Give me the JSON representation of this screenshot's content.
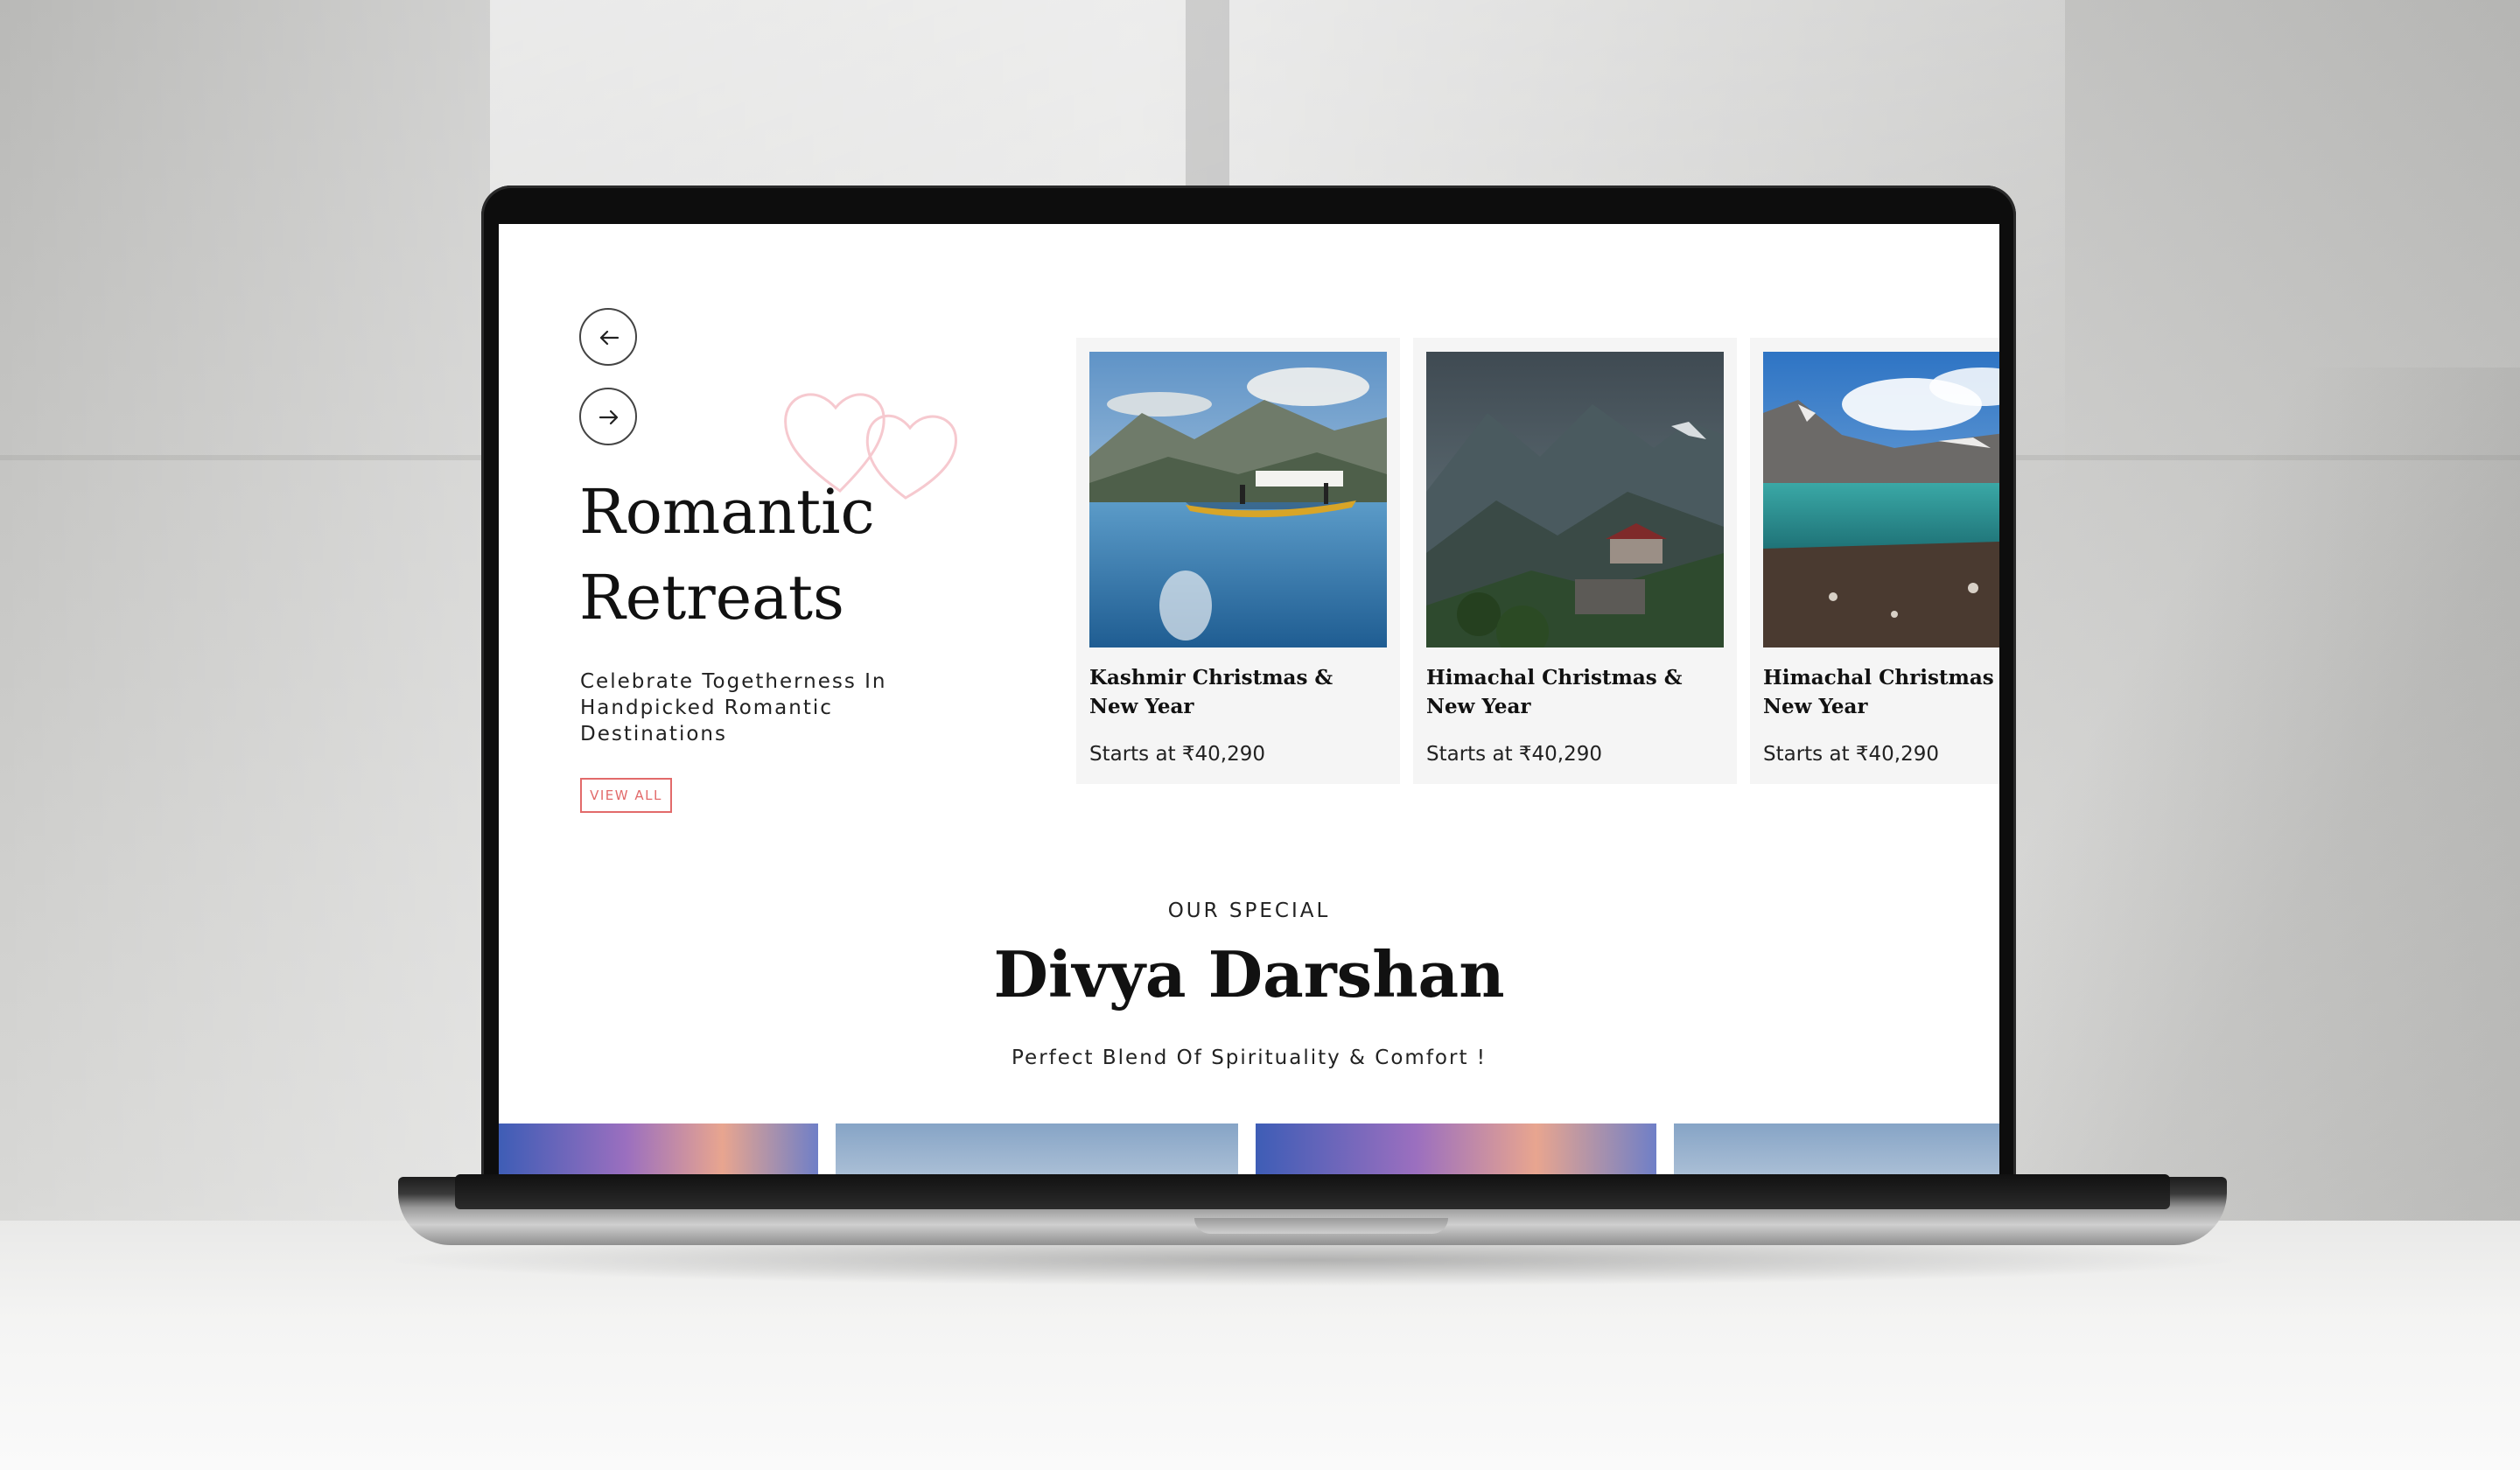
{
  "carousel": {
    "prev_icon": "arrow-left-icon",
    "next_icon": "arrow-right-icon",
    "decor_icon": "hearts-icon"
  },
  "romantic": {
    "title": "Romantic Retreats",
    "subtitle": "Celebrate Togetherness In Handpicked Romantic Destinations",
    "view_all": "VIEW ALL",
    "accent_color": "#e26a6a"
  },
  "cards": [
    {
      "name": "Kashmir Christmas & New Year",
      "price": "Starts at ₹40,290"
    },
    {
      "name": "Himachal Christmas & New Year",
      "price": "Starts at ₹40,290"
    },
    {
      "name": "Himachal Christmas & New Year",
      "price": "Starts at ₹40,290"
    }
  ],
  "divya": {
    "eyebrow": "OUR SPECIAL",
    "title": "Divya Darshan",
    "subtitle": "Perfect Blend Of Spirituality & Comfort !"
  }
}
